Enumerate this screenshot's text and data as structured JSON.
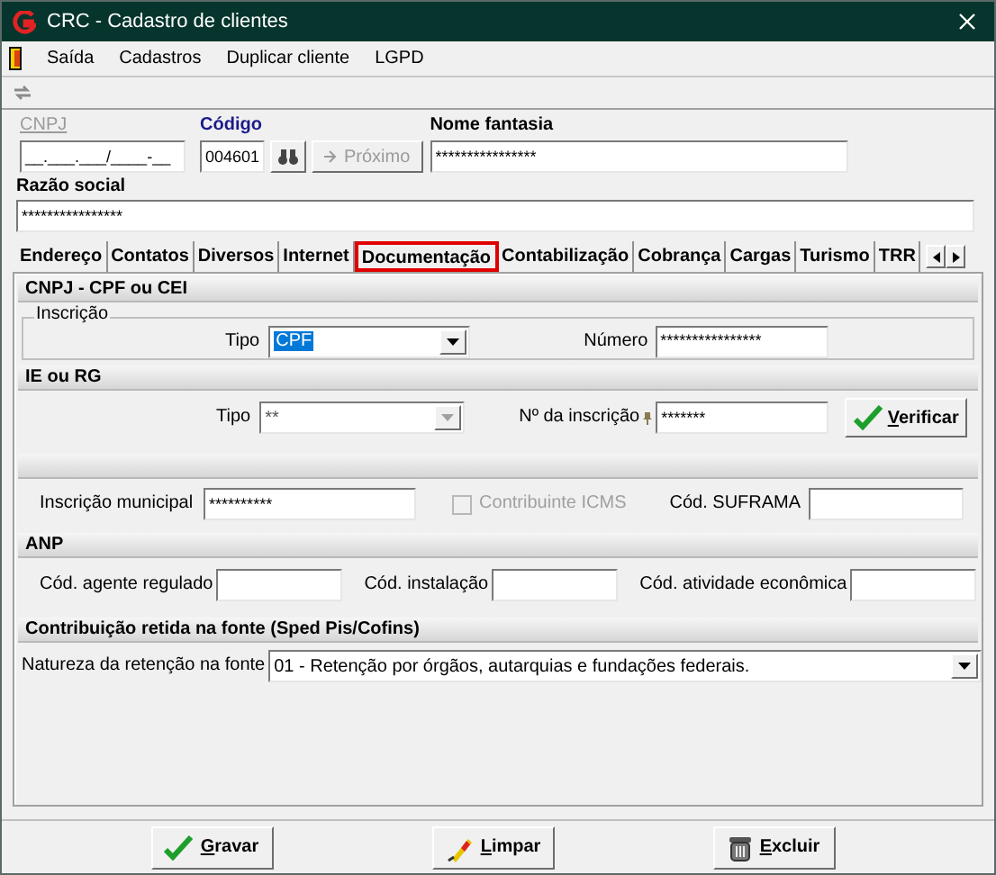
{
  "window": {
    "title": "CRC - Cadastro de clientes"
  },
  "menu": [
    "Saída",
    "Cadastros",
    "Duplicar cliente",
    "LGPD"
  ],
  "header": {
    "cnpj": {
      "label": "CNPJ",
      "value": "__.___.___/____-__",
      "disabled": true
    },
    "codigo": {
      "label": "Código",
      "value": "004601"
    },
    "proximo": {
      "label": "Próximo",
      "disabled": true
    },
    "nome_fantasia": {
      "label": "Nome fantasia",
      "value": "****************"
    },
    "razao_social": {
      "label": "Razão social",
      "value": "****************"
    }
  },
  "tabs": [
    {
      "label": "Endereço",
      "selected": false
    },
    {
      "label": "Contatos",
      "selected": false
    },
    {
      "label": "Diversos",
      "selected": false
    },
    {
      "label": "Internet",
      "selected": false
    },
    {
      "label": "Documentação",
      "selected": true
    },
    {
      "label": "Contabilização",
      "selected": false
    },
    {
      "label": "Cobrança",
      "selected": false
    },
    {
      "label": "Cargas",
      "selected": false
    },
    {
      "label": "Turismo",
      "selected": false
    },
    {
      "label": "TRR",
      "selected": false
    }
  ],
  "cnpj_cpf": {
    "title": "CNPJ - CPF ou CEI",
    "group": "Inscrição",
    "tipo": {
      "label": "Tipo",
      "value": "CPF",
      "focused": true,
      "disabled": false
    },
    "numero": {
      "label": "Número",
      "value": "****************"
    }
  },
  "ie_rg": {
    "title": "IE ou RG",
    "tipo": {
      "label": "Tipo",
      "value": "**",
      "focused": false,
      "disabled": true
    },
    "numero": {
      "label": "Nº da inscrição",
      "value": "*******"
    },
    "verificar": "Verificar"
  },
  "outros": {
    "inscricao_municipal": {
      "label": "Inscrição municipal",
      "value": "**********"
    },
    "contribuinte_icms": {
      "label": "Contribuinte ICMS",
      "checked": false,
      "disabled": true
    },
    "suframa": {
      "label": "Cód. SUFRAMA"
    }
  },
  "anp": {
    "title": "ANP",
    "fields": [
      {
        "label": "Cód. agente regulado"
      },
      {
        "label": "Cód. instalação"
      },
      {
        "label": "Cód. atividade econômica"
      }
    ]
  },
  "contribuicao": {
    "title": "Contribuição retida na fonte  (Sped Pis/Cofins)",
    "natureza": {
      "label": "Natureza da retenção na fonte",
      "value": "01 - Retenção por órgãos, autarquias e fundações federais.",
      "focused": false,
      "disabled": false
    }
  },
  "buttons": [
    {
      "kind": "save",
      "label": "Gravar"
    },
    {
      "kind": "clear",
      "label": "Limpar"
    },
    {
      "kind": "delete",
      "label": "Excluir"
    }
  ]
}
